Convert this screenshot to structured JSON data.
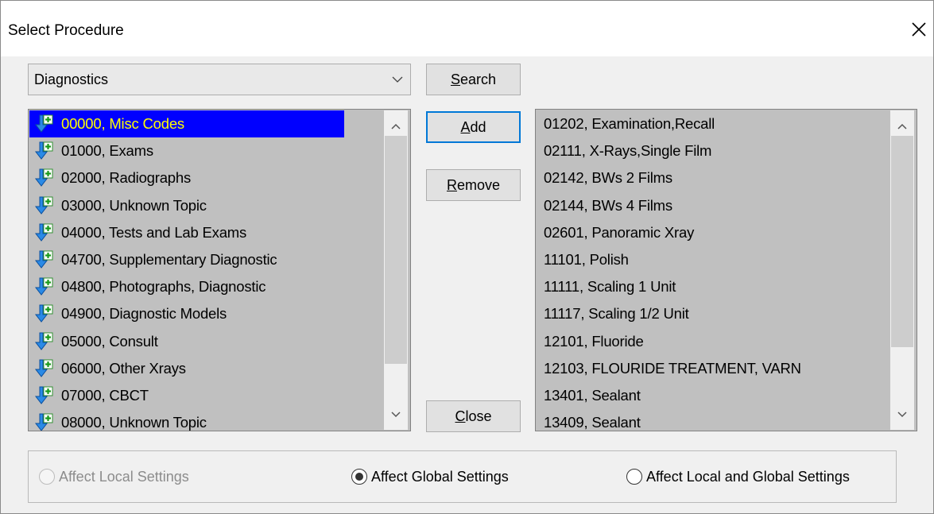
{
  "window": {
    "title": "Select Procedure"
  },
  "category_combo": {
    "value": "Diagnostics"
  },
  "buttons": {
    "search": {
      "mnemonic": "S",
      "rest": "earch"
    },
    "add": {
      "mnemonic": "A",
      "rest": "dd"
    },
    "remove": {
      "mnemonic": "R",
      "rest": "emove"
    },
    "close": {
      "mnemonic": "C",
      "rest": "lose"
    }
  },
  "left_list": {
    "items": [
      "00000, Misc Codes",
      "01000, Exams",
      "02000, Radiographs",
      "03000, Unknown Topic",
      "04000, Tests and Lab Exams",
      "04700, Supplementary Diagnostic",
      "04800, Photographs, Diagnostic",
      "04900, Diagnostic Models",
      "05000, Consult",
      "06000, Other Xrays",
      "07000, CBCT",
      "08000, Unknown Topic"
    ],
    "selected_index": 0
  },
  "right_list": {
    "items": [
      "01202, Examination,Recall",
      "02111, X-Rays,Single Film",
      "02142, BWs 2 Films",
      "02144, BWs 4 Films",
      "02601, Panoramic Xray",
      "11101, Polish",
      "11111, Scaling 1 Unit",
      "11117, Scaling 1/2 Unit",
      "12101, Fluoride",
      "12103, FLOURIDE TREATMENT, VARN",
      "13401, Sealant",
      "13409, Sealant"
    ]
  },
  "settings_radios": [
    {
      "label": "Affect Local Settings",
      "checked": false,
      "disabled": true
    },
    {
      "label": "Affect Global Settings",
      "checked": true,
      "disabled": false
    },
    {
      "label": "Affect Local and Global Settings",
      "checked": false,
      "disabled": false
    }
  ],
  "colors": {
    "selection_bg": "#0000ff",
    "selection_fg": "#ffff00",
    "list_bg": "#c0c0c0",
    "focus_border": "#0078d7"
  },
  "icons": {
    "list_item": "procedure-add-icon",
    "close": "close-icon",
    "dropdown": "chevron-down-icon"
  }
}
